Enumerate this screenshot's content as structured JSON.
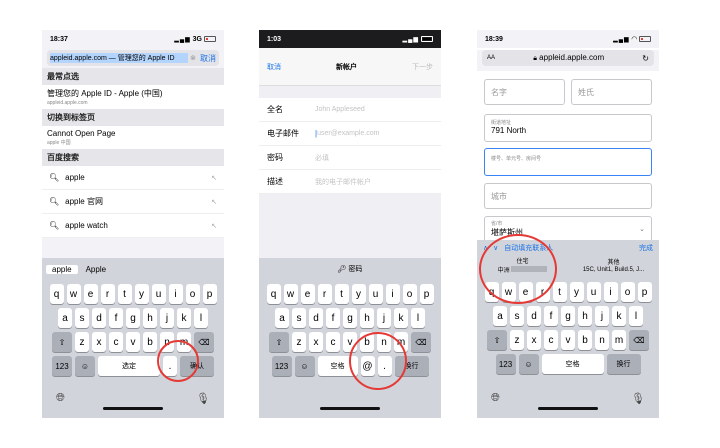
{
  "phone1": {
    "time": "18:37",
    "network": "3G",
    "url_text": "appleid.apple.com — 管理您的 Apple ID",
    "cancel": "取消",
    "sec_suggested": "最常点选",
    "item1_title": "管理您的 Apple ID - Apple (中国)",
    "item1_sub": "appleid.apple.com",
    "sec_tab": "切换到标签页",
    "item2_title": "Cannot Open Page",
    "item2_sub": "apple 中国",
    "sec_baidu": "百度搜索",
    "searches": [
      "apple",
      "apple 官网",
      "apple watch"
    ],
    "suggestions": [
      "apple",
      "Apple"
    ],
    "key_rows": [
      [
        "q",
        "w",
        "e",
        "r",
        "t",
        "y",
        "u",
        "i",
        "o",
        "p"
      ],
      [
        "a",
        "s",
        "d",
        "f",
        "g",
        "h",
        "j",
        "k",
        "l"
      ],
      [
        "z",
        "x",
        "c",
        "v",
        "b",
        "n",
        "m"
      ]
    ],
    "num_key": "123",
    "space_label": "选定",
    "dot_key": ".",
    "confirm_label": "确认"
  },
  "phone2": {
    "time": "1:03",
    "cancel": "取消",
    "title": "新帐户",
    "next": "下一步",
    "fields": [
      {
        "label": "全名",
        "placeholder": "John Appleseed"
      },
      {
        "label": "电子邮件",
        "placeholder": "user@example.com"
      },
      {
        "label": "密码",
        "placeholder": "必填"
      },
      {
        "label": "描述",
        "placeholder": "我的电子邮件帐户"
      }
    ],
    "pwd_label": "密码",
    "key_rows": [
      [
        "q",
        "w",
        "e",
        "r",
        "t",
        "y",
        "u",
        "i",
        "o",
        "p"
      ],
      [
        "a",
        "s",
        "d",
        "f",
        "g",
        "h",
        "j",
        "k",
        "l"
      ],
      [
        "z",
        "x",
        "c",
        "v",
        "b",
        "n",
        "m"
      ]
    ],
    "num_key": "123",
    "space_label": "空格",
    "at_key": "@",
    "dot_key": ".",
    "go_label": "换行"
  },
  "phone3": {
    "time": "18:39",
    "aa": "AA",
    "domain": "appleid.apple.com",
    "first_name": "名字",
    "last_name": "姓氏",
    "street_small": "街道地址",
    "street_val": "791 North",
    "apt_small": "楼号、单元号、房间号",
    "city": "城市",
    "state_small": "省/市",
    "state_val": "堪萨斯州",
    "autofill": "自动填充联系人",
    "done": "完成",
    "ac_left_title": "住宅",
    "ac_left_sub": "中洲",
    "ac_right_title": "其他",
    "ac_right_sub": "15C, Unit1, Build.5, J...",
    "key_rows": [
      [
        "q",
        "w",
        "e",
        "r",
        "t",
        "y",
        "u",
        "i",
        "o",
        "p"
      ],
      [
        "a",
        "s",
        "d",
        "f",
        "g",
        "h",
        "j",
        "k",
        "l"
      ],
      [
        "z",
        "x",
        "c",
        "v",
        "b",
        "n",
        "m"
      ]
    ],
    "num_key": "123",
    "space_label": "空格",
    "go_label": "换行"
  }
}
